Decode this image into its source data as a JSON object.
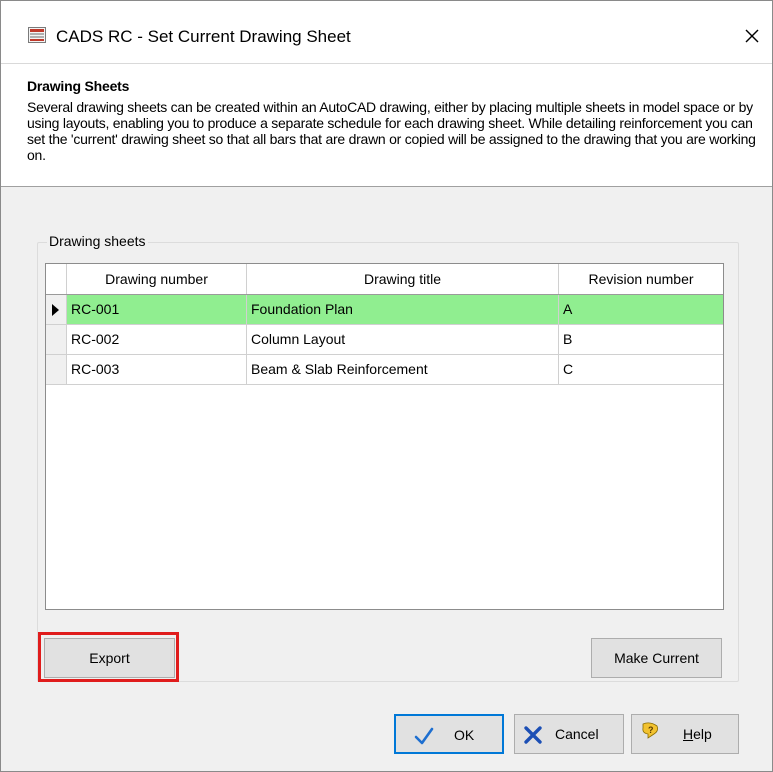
{
  "window": {
    "title": "CADS RC - Set Current Drawing Sheet",
    "close_symbol": "✕"
  },
  "header": {
    "title": "Drawing Sheets",
    "description": "Several drawing sheets can be created within an AutoCAD drawing, either by placing multiple sheets in model space or by using layouts, enabling you to produce a separate schedule for each drawing sheet. While detailing reinforcement you can set the 'current' drawing sheet so that all bars that are drawn or copied will be assigned to the drawing that you are working on."
  },
  "group": {
    "legend": "Drawing sheets"
  },
  "grid": {
    "columns": [
      "Drawing number",
      "Drawing title",
      "Revision number"
    ],
    "rows": [
      {
        "number": "RC-001",
        "title": "Foundation Plan",
        "revision": "A",
        "selected": true
      },
      {
        "number": "RC-002",
        "title": "Column Layout",
        "revision": "B",
        "selected": false
      },
      {
        "number": "RC-003",
        "title": "Beam & Slab Reinforcement",
        "revision": "C",
        "selected": false
      }
    ],
    "selected_color": "#90ee90"
  },
  "buttons": {
    "export": "Export",
    "make_current": "Make Current",
    "ok": "OK",
    "cancel": "Cancel",
    "help": "Help"
  },
  "icons": {
    "app": "cads-app-icon",
    "ok": "checkmark-icon",
    "cancel": "x-icon",
    "help": "help-question-icon"
  },
  "colors": {
    "highlight_box": "#e01c1c",
    "ok_border": "#0078d7"
  }
}
